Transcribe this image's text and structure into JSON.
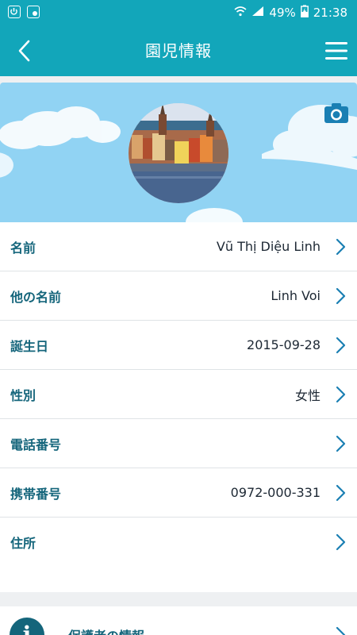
{
  "status_bar": {
    "battery": "49%",
    "time": "21:38"
  },
  "app_bar": {
    "title": "園児情報"
  },
  "profile": {
    "fields": [
      {
        "label": "名前",
        "value": "Vũ Thị Diệu Linh"
      },
      {
        "label": "他の名前",
        "value": "Linh Voi"
      },
      {
        "label": "誕生日",
        "value": "2015-09-28"
      },
      {
        "label": "性別",
        "value": "女性"
      },
      {
        "label": "電話番号",
        "value": ""
      },
      {
        "label": "携帯番号",
        "value": "0972-000-331"
      },
      {
        "label": "住所",
        "value": ""
      }
    ]
  },
  "guardian": {
    "label": "保護者の情報",
    "icon_letter": "i"
  },
  "colors": {
    "primary": "#12a6ba",
    "label": "#14657b",
    "sky": "#91d3f3",
    "chevron": "#1a7fb3"
  },
  "icons": [
    "power-icon",
    "screen-icon",
    "wifi-icon",
    "signal-icon",
    "battery-icon",
    "back-arrow-icon",
    "menu-icon",
    "camera-icon",
    "chevron-right-icon",
    "info-icon"
  ]
}
